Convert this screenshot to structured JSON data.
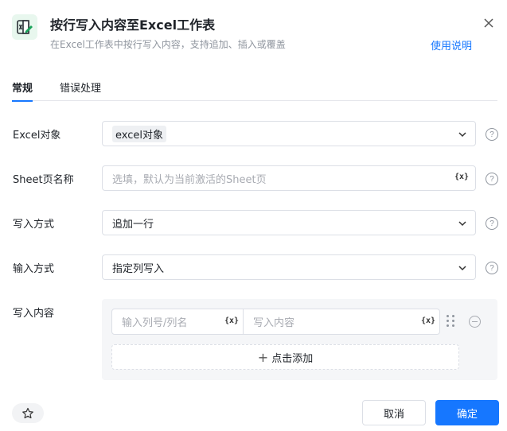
{
  "header": {
    "title": "按行写入内容至Excel工作表",
    "subtitle": "在Excel工作表中按行写入内容，支持追加、插入或覆盖",
    "help_label": "使用说明",
    "app_icon": "excel-write-icon",
    "close_icon": "close-icon"
  },
  "tabs": [
    {
      "label": "常规",
      "active": true
    },
    {
      "label": "错误处理",
      "active": false
    }
  ],
  "form": {
    "excel_object": {
      "label": "Excel对象",
      "value": "excel对象"
    },
    "sheet_name": {
      "label": "Sheet页名称",
      "placeholder": "选填，默认为当前激活的Sheet页",
      "var_icon": "{x}"
    },
    "write_mode": {
      "label": "写入方式",
      "value": "追加一行"
    },
    "input_mode": {
      "label": "输入方式",
      "value": "指定列写入"
    },
    "write_content": {
      "label": "写入内容",
      "column_placeholder": "输入列号/列名",
      "content_placeholder": "写入内容",
      "var_icon": "{x}",
      "add_label": "点击添加"
    }
  },
  "footer": {
    "cancel_label": "取消",
    "confirm_label": "确定",
    "favorite_icon": "star-icon"
  },
  "colors": {
    "accent": "#1677ff",
    "excel_green": "#1aa35a"
  }
}
